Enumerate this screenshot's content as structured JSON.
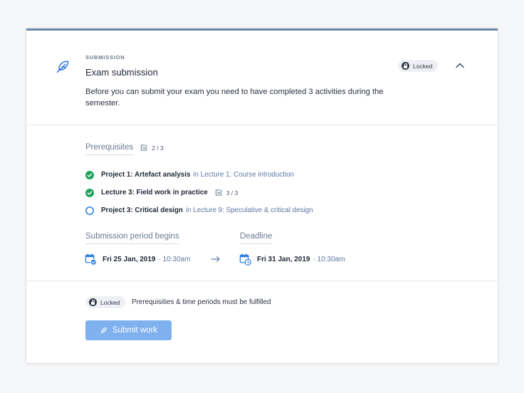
{
  "header": {
    "overline": "SUBMISSION",
    "title": "Exam submission",
    "status_badge": "Locked",
    "description": "Before you can submit your exam you need to have completed 3 activities during the semester.",
    "icon": "feather-icon",
    "collapse_icon": "chevron-up-icon"
  },
  "prerequisites": {
    "heading": "Prerequisites",
    "count": "2 / 3",
    "items": [
      {
        "name": "Project 1: Artefact analysis",
        "context": "in Lecture 1: Course introduction",
        "status": "complete",
        "count": ""
      },
      {
        "name": "Lecture 3: Field work in practice",
        "context": "",
        "status": "complete",
        "count": "3 / 3"
      },
      {
        "name": "Project 3: Critical design",
        "context": "in Lecture 9: Speculative & critical design",
        "status": "incomplete",
        "count": ""
      }
    ]
  },
  "period": {
    "start_heading": "Submission period begins",
    "start_date": "Fri 25 Jan, 2019",
    "start_time": "· 10:30am",
    "deadline_heading": "Deadline",
    "end_date": "Fri 31 Jan, 2019",
    "end_time": "· 10:30am"
  },
  "footer": {
    "status_badge": "Locked",
    "message": "Prerequisities & time periods must be fulfilled",
    "submit_label": "Submit work"
  },
  "colors": {
    "accent_bar": "#6e86a6",
    "complete_green": "#1fa35c",
    "incomplete_blue": "#2f7ee0",
    "link_text": "#5d78a3",
    "button_disabled": "#7fb1ef"
  }
}
